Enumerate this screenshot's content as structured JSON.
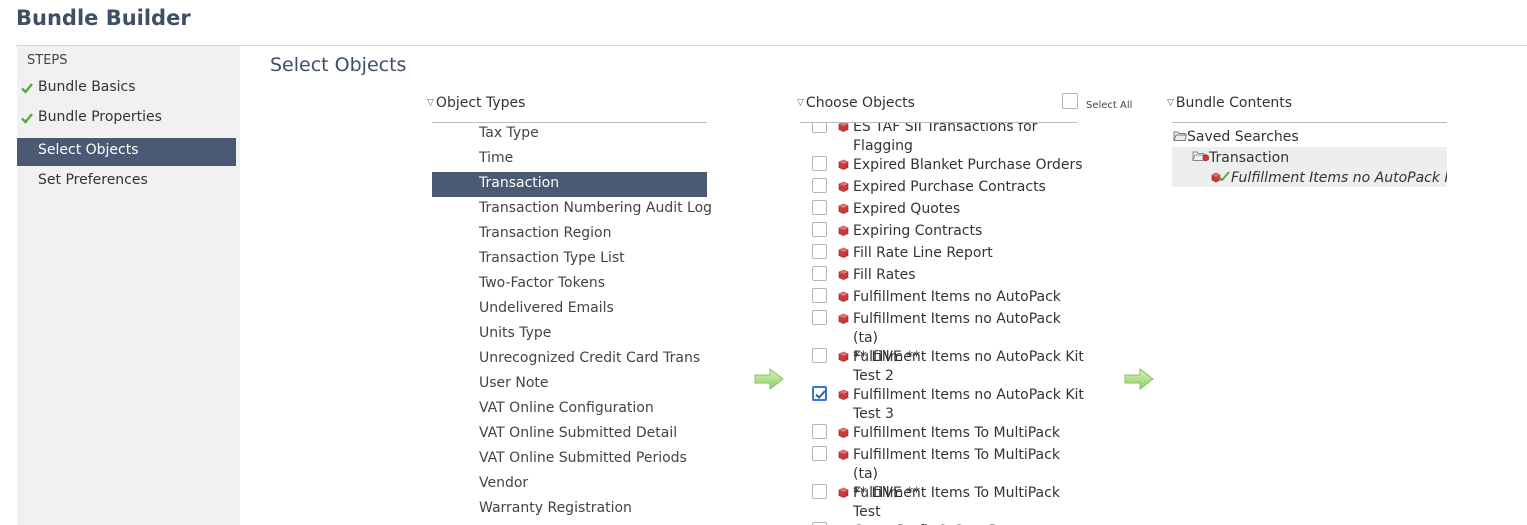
{
  "page": {
    "title": "Bundle Builder"
  },
  "sidebar": {
    "steps_label": "STEPS",
    "items": [
      {
        "label": "Bundle Basics",
        "done": true
      },
      {
        "label": "Bundle Properties",
        "done": true
      },
      {
        "label": "Select Objects",
        "active": true
      },
      {
        "label": "Set Preferences"
      }
    ]
  },
  "main": {
    "title": "Select Objects"
  },
  "object_types": {
    "header": "Object Types",
    "items": [
      "Tax Type",
      "Time",
      "Transaction",
      "Transaction Numbering Audit Log",
      "Transaction Region",
      "Transaction Type List",
      "Two-Factor Tokens",
      "Undelivered Emails",
      "Units Type",
      "Unrecognized Credit Card Trans",
      "User Note",
      "VAT Online Configuration",
      "VAT Online Submitted Detail",
      "VAT Online Submitted Periods",
      "Vendor",
      "Warranty Registration"
    ],
    "selected": "Transaction"
  },
  "choose_objects": {
    "header": "Choose Objects",
    "select_all_label": "Select All",
    "items": [
      {
        "line1": "ES TAF SII Transactions for",
        "line2": "Flagging",
        "checked": false
      },
      {
        "line1": "Expired Blanket Purchase Orders",
        "checked": false
      },
      {
        "line1": "Expired Purchase Contracts",
        "checked": false
      },
      {
        "line1": "Expired Quotes",
        "checked": false
      },
      {
        "line1": "Expiring Contracts",
        "checked": false
      },
      {
        "line1": "Fill Rate Line Report",
        "checked": false
      },
      {
        "line1": "Fill Rates",
        "checked": false
      },
      {
        "line1": "Fulfillment Items no AutoPack",
        "checked": false
      },
      {
        "line1": "Fulfillment Items no AutoPack (ta)",
        "line2": "** LIVE **",
        "checked": false
      },
      {
        "line1": "Fulfillment Items no AutoPack Kit",
        "line2": "Test 2",
        "checked": false
      },
      {
        "line1": "Fulfillment Items no AutoPack Kit",
        "line2": "Test 3",
        "checked": true
      },
      {
        "line1": "Fulfillment Items To MultiPack",
        "checked": false
      },
      {
        "line1": "Fulfillment Items To MultiPack (ta)",
        "line2": "** LIVE **",
        "checked": false
      },
      {
        "line1": "Fulfillment Items To MultiPack",
        "line2": "Test",
        "checked": false
      },
      {
        "line1": "Gross Profit & Cost Report",
        "checked": false
      }
    ]
  },
  "bundle_contents": {
    "header": "Bundle Contents",
    "root": "Saved Searches",
    "group": "Transaction",
    "item": "Fulfillment Items no AutoPack Kit"
  },
  "colors": {
    "accent": "#4a5a72",
    "title": "#3e4f68",
    "check": "#3b74d6"
  }
}
